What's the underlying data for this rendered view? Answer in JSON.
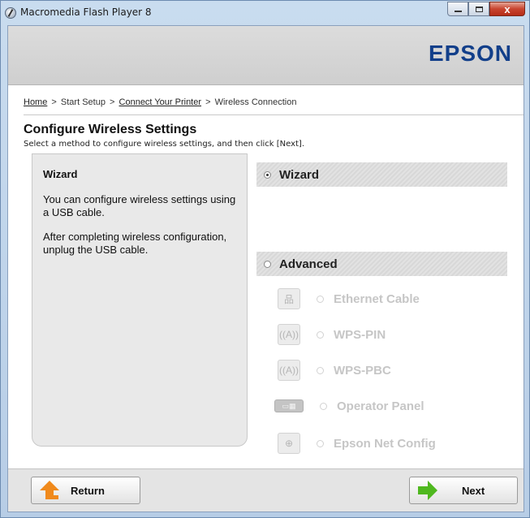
{
  "window": {
    "title": "Macromedia Flash Player 8",
    "close_glyph": "x"
  },
  "brand": {
    "name": "EPSON",
    "color": "#123f8a"
  },
  "breadcrumb": {
    "home": "Home",
    "sep1": ">",
    "start_setup": "Start Setup",
    "sep2": ">",
    "connect": "Connect Your Printer",
    "sep3": ">",
    "current": "Wireless Connection"
  },
  "page": {
    "title": "Configure Wireless Settings",
    "subtitle": "Select a method to configure wireless settings, and then click [Next]."
  },
  "description": {
    "title": "Wizard",
    "para1": "You can configure wireless settings using a USB cable.",
    "para2": "After completing wireless configuration, unplug the USB cable."
  },
  "options": {
    "wizard": {
      "label": "Wizard",
      "selected": true
    },
    "advanced": {
      "label": "Advanced",
      "selected": false
    },
    "sub": [
      {
        "label": "Ethernet Cable",
        "icon": "network-icon",
        "glyph": "品"
      },
      {
        "label": "WPS-PIN",
        "icon": "wireless-antenna-icon",
        "glyph": "((A))"
      },
      {
        "label": "WPS-PBC",
        "icon": "wireless-antenna-icon",
        "glyph": "((A))"
      },
      {
        "label": "Operator Panel",
        "icon": "operator-panel-icon",
        "glyph": "▭▦"
      },
      {
        "label": "Epson Net Config",
        "icon": "globe-gear-icon",
        "glyph": "⊕"
      }
    ]
  },
  "buttons": {
    "return": "Return",
    "next": "Next"
  }
}
